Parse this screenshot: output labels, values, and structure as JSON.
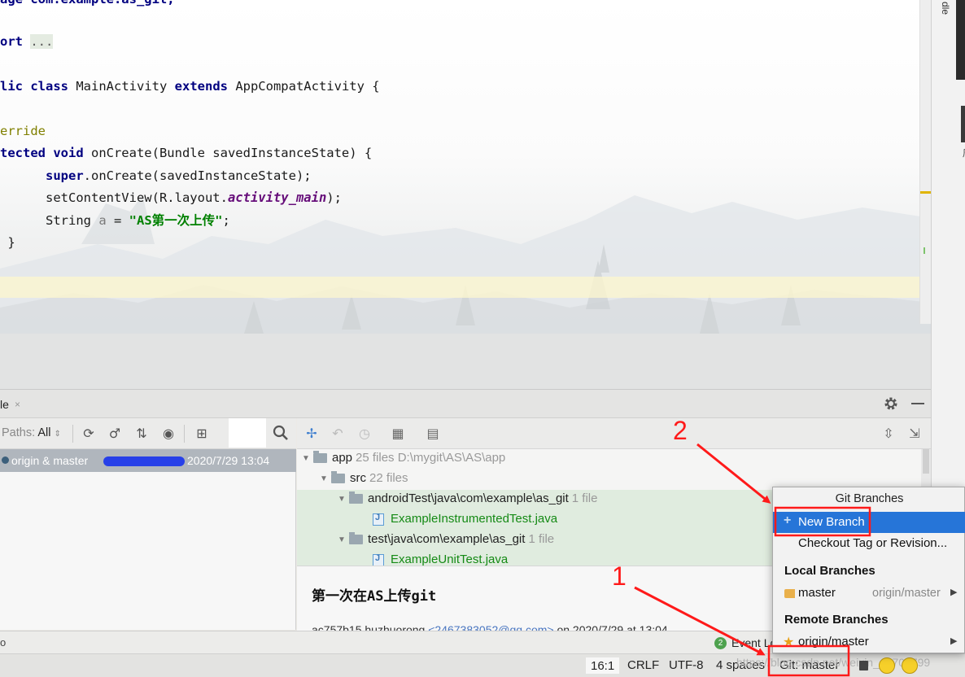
{
  "editor": {
    "lines": [
      "age com.example.as_git;",
      "ort ...",
      "lic class MainActivity extends AppCompatActivity {",
      "erride",
      "tected void onCreate(Bundle savedInstanceState) {",
      "super.onCreate(savedInstanceState);",
      "setContentView(R.layout.activity_main);",
      "String a = \"AS第一次上传\";",
      "}"
    ],
    "right_edge_text": "dle"
  },
  "tool_window": {
    "tab_label": "le",
    "tab_close": "×",
    "paths_label": "Paths:",
    "paths_value": "All",
    "commit": {
      "refs": "origin & master",
      "date": "2020/7/29 13:04"
    }
  },
  "changes_tree": {
    "rows": [
      {
        "name": "app",
        "meta": "25 files  D:\\mygit\\AS\\AS\\app"
      },
      {
        "name": "src",
        "meta": "22 files"
      },
      {
        "name": "androidTest\\java\\com\\example\\as_git",
        "meta": "1 file"
      },
      {
        "name": "ExampleInstrumentedTest.java"
      },
      {
        "name": "test\\java\\com\\example\\as_git",
        "meta": "1 file"
      },
      {
        "name": "ExampleUnitTest.java"
      }
    ]
  },
  "details": {
    "message": "第一次在AS上传git",
    "hash": "ac757b15 huzhuorong",
    "email": "<2467383052@qq.com>",
    "date": "on 2020/7/29 at 13:04"
  },
  "problems_bar": {
    "left_text": "o",
    "event_count": "2",
    "event_log": "Event Log"
  },
  "status_bar": {
    "position": "16:1",
    "line_sep": "CRLF",
    "encoding": "UTF-8",
    "indent": "4 spaces",
    "vcs": "Git: master",
    "watermark": "https://blog.csdn.net/weixin_43707799"
  },
  "git_popup": {
    "title": "Git Branches",
    "new_branch": "New Branch",
    "new_branch_icon": "+",
    "checkout": "Checkout Tag or Revision...",
    "local_header": "Local Branches",
    "local_branch": "master",
    "local_tracking": "origin/master",
    "remote_header": "Remote Branches",
    "remote_branch": "origin/master"
  },
  "annotations": {
    "label_1": "1",
    "label_2": "2",
    "color": "#ff1a1a"
  },
  "colors": {
    "selection": "#2675d8",
    "keyword": "#000080",
    "string": "#008000",
    "annotation": "#808000"
  }
}
